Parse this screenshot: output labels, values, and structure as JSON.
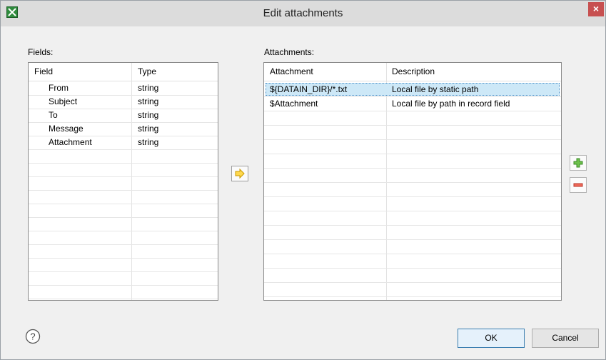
{
  "window": {
    "title": "Edit attachments",
    "close_glyph": "×",
    "app_icon": "app-icon"
  },
  "fields": {
    "label": "Fields:",
    "columns": [
      "Field",
      "Type"
    ],
    "rows": [
      {
        "field": "From",
        "type": "string"
      },
      {
        "field": "Subject",
        "type": "string"
      },
      {
        "field": "To",
        "type": "string"
      },
      {
        "field": "Message",
        "type": "string"
      },
      {
        "field": "Attachment",
        "type": "string"
      }
    ]
  },
  "attachments": {
    "label": "Attachments:",
    "columns": [
      "Attachment",
      "Description"
    ],
    "rows": [
      {
        "attachment": "${DATAIN_DIR}/*.txt",
        "description": "Local file by static path",
        "selected": true
      },
      {
        "attachment": "$Attachment",
        "description": "Local file by path in record field",
        "selected": false
      }
    ]
  },
  "actions": {
    "move_right_icon": "arrow-right-icon",
    "add_icon": "plus-icon",
    "remove_icon": "minus-icon"
  },
  "buttons": {
    "ok": "OK",
    "cancel": "Cancel",
    "help_icon": "help-icon"
  },
  "colors": {
    "selection": "#cde8f7",
    "add": "#4caf50",
    "remove": "#e53935",
    "arrow": "#f0b400",
    "close": "#c75050"
  }
}
